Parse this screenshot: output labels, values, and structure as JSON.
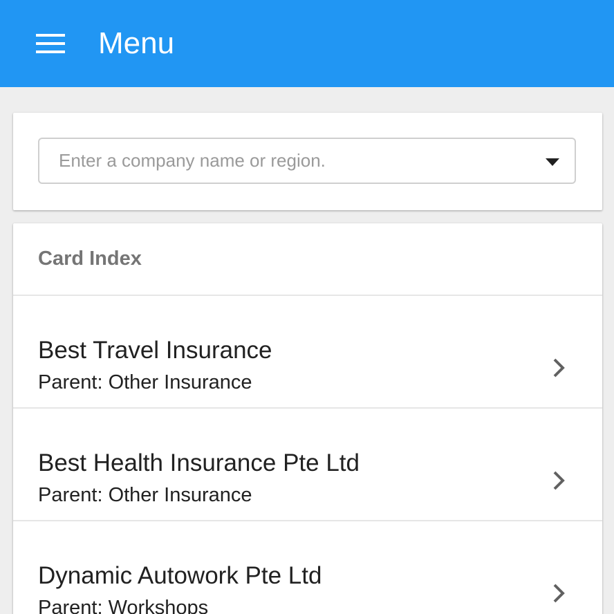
{
  "appbar": {
    "title": "Menu",
    "menu_icon": "hamburger-menu-icon",
    "background_color": "#2196f3"
  },
  "search": {
    "placeholder": "Enter a company name or region.",
    "value": "",
    "dropdown_icon": "caret-down-icon"
  },
  "card_index": {
    "header": "Card Index",
    "items": [
      {
        "name": "Best Travel Insurance",
        "parent_label": "Parent:",
        "parent": "Other Insurance"
      },
      {
        "name": "Best Health Insurance Pte Ltd",
        "parent_label": "Parent:",
        "parent": "Other Insurance"
      },
      {
        "name": "Dynamic Autowork Pte Ltd",
        "parent_label": "Parent:",
        "parent": "Workshops"
      }
    ],
    "item_icon": "chevron-right-icon"
  }
}
